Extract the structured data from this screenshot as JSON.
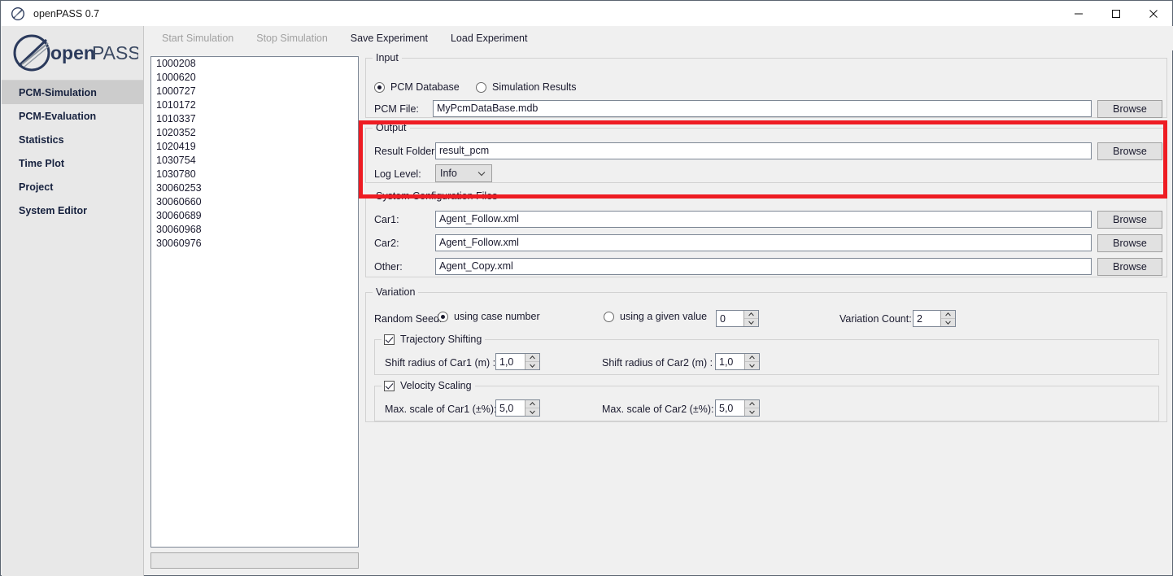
{
  "window": {
    "title": "openPASS 0.7",
    "app_icon": "openpass-logo-icon",
    "minimize": "minimize-icon",
    "maximize": "maximize-icon",
    "close": "close-icon"
  },
  "sidebar": {
    "logo_text": "openPASS",
    "items": [
      {
        "label": "PCM-Simulation",
        "selected": true
      },
      {
        "label": "PCM-Evaluation",
        "selected": false
      },
      {
        "label": "Statistics",
        "selected": false
      },
      {
        "label": "Time Plot",
        "selected": false
      },
      {
        "label": "Project",
        "selected": false
      },
      {
        "label": "System Editor",
        "selected": false
      }
    ]
  },
  "menubar": {
    "items": [
      {
        "label": "Start Simulation",
        "disabled": true
      },
      {
        "label": "Stop Simulation",
        "disabled": true
      },
      {
        "label": "Save Experiment",
        "disabled": false
      },
      {
        "label": "Load Experiment",
        "disabled": false
      }
    ]
  },
  "case_list": {
    "items": [
      "1000208",
      "1000620",
      "1000727",
      "1010172",
      "1010337",
      "1020352",
      "1020419",
      "1030754",
      "1030780",
      "30060253",
      "30060660",
      "30060689",
      "30060968",
      "30060976"
    ]
  },
  "progress": {
    "value": ""
  },
  "input_group": {
    "legend": "Input",
    "radio_pcm_database": "PCM Database",
    "radio_simulation_results": "Simulation Results",
    "pcm_file_label": "PCM File:",
    "pcm_file_value": "MyPcmDataBase.mdb",
    "browse_label": "Browse"
  },
  "output_group": {
    "legend": "Output",
    "result_folder_label": "Result Folder:",
    "result_folder_value": "result_pcm",
    "browse_label": "Browse",
    "log_level_label": "Log Level:",
    "log_level_value": "Info",
    "highlight_color": "#ee1c23"
  },
  "sysconfig_group": {
    "legend": "System Configuration Files",
    "rows": [
      {
        "label": "Car1:",
        "value": "Agent_Follow.xml",
        "browse": "Browse"
      },
      {
        "label": "Car2:",
        "value": "Agent_Follow.xml",
        "browse": "Browse"
      },
      {
        "label": "Other:",
        "value": "Agent_Copy.xml",
        "browse": "Browse"
      }
    ]
  },
  "variation_group": {
    "legend": "Variation",
    "random_seed_label": "Random Seed:",
    "radio_case_number": "using case number",
    "radio_given_value": "using a given value",
    "given_value": "0",
    "variation_count_label": "Variation Count:",
    "variation_count_value": "2",
    "trajectory": {
      "legend": "Trajectory Shifting",
      "checked": true,
      "car1_label": "Shift radius of Car1 (m) :",
      "car1_value": "1,0",
      "car2_label": "Shift radius of Car2 (m) :",
      "car2_value": "1,0"
    },
    "velocity": {
      "legend": "Velocity Scaling",
      "checked": true,
      "car1_label": "Max. scale of Car1 (±%):",
      "car1_value": "5,0",
      "car2_label": "Max. scale of Car2 (±%):",
      "car2_value": "5,0"
    }
  }
}
